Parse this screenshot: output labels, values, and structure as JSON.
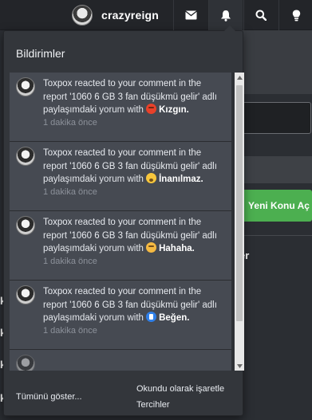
{
  "navbar": {
    "username": "crazyreign",
    "icons": [
      "envelope-icon",
      "bell-icon",
      "search-icon",
      "lightbulb-icon"
    ]
  },
  "background": {
    "new_thread_button": "Yeni Konu Aç",
    "fragment_text": "er",
    "left_fragments": [
      "k",
      "k",
      "k",
      "k"
    ]
  },
  "notifications": {
    "title": "Bildirimler",
    "items": [
      {
        "user": "Toxpox",
        "action": "reacted to",
        "target": "your comment",
        "context_prefix": "in the report",
        "report": "'1060 6 GB 3 fan düşükmü gelir'",
        "context_suffix": "adlı paylaşımdaki yorum with",
        "reaction_icon": "angry-emoji-icon",
        "reaction": "Kızgın.",
        "time": "1 dakika önce"
      },
      {
        "user": "Toxpox",
        "action": "reacted to",
        "target": "your comment",
        "context_prefix": "in the report",
        "report": "'1060 6 GB 3 fan düşükmü gelir'",
        "context_suffix": "adlı paylaşımdaki yorum with",
        "reaction_icon": "wow-emoji-icon",
        "reaction": "İnanılmaz.",
        "time": "1 dakika önce"
      },
      {
        "user": "Toxpox",
        "action": "reacted to",
        "target": "your comment",
        "context_prefix": "in the report",
        "report": "'1060 6 GB 3 fan düşükmü gelir'",
        "context_suffix": "adlı paylaşımdaki yorum with",
        "reaction_icon": "laughing-emoji-icon",
        "reaction": "Hahaha.",
        "time": "1 dakika önce"
      },
      {
        "user": "Toxpox",
        "action": "reacted to",
        "target": "your comment",
        "context_prefix": "in the report",
        "report": "'1060 6 GB 3 fan düşükmü gelir'",
        "context_suffix": "adlı paylaşımdaki yorum with",
        "reaction_icon": "like-emoji-icon",
        "reaction": "Beğen.",
        "time": "1 dakika önce"
      }
    ],
    "footer": {
      "show_all": "Tümünü göster...",
      "mark_read": "Okundu olarak işaretle",
      "preferences": "Tercihler"
    }
  },
  "colors": {
    "navbar_bg": "#232529",
    "dropdown_bg": "#33363b",
    "notif_bg": "#464a52",
    "accent_green": "#4caf50"
  }
}
